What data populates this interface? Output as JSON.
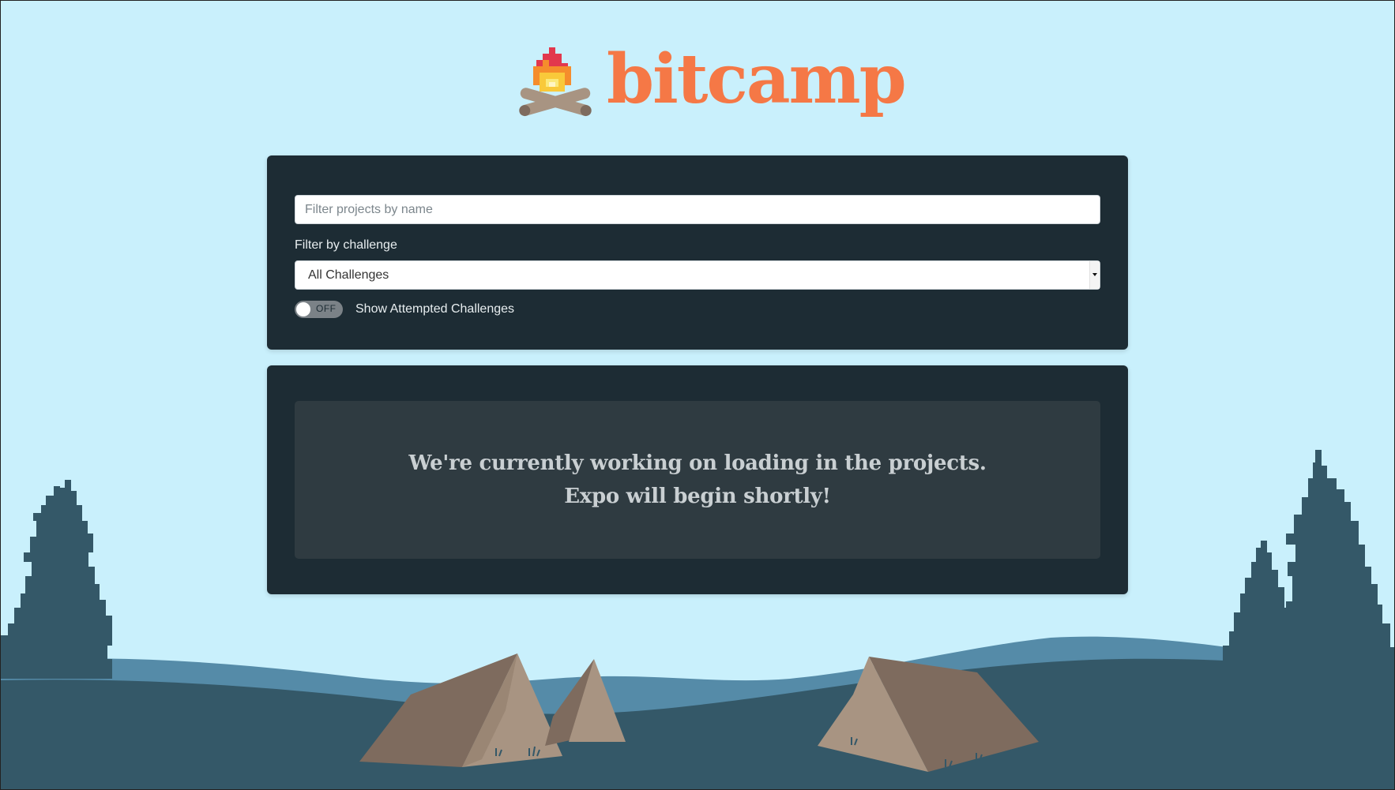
{
  "brand": {
    "name": "bitcamp",
    "accent_color": "#f57846",
    "icon": "campfire-icon"
  },
  "filters": {
    "search_placeholder": "Filter projects by name",
    "search_value": "",
    "challenge_label": "Filter by challenge",
    "challenge_selected": "All Challenges",
    "toggle_state": "OFF",
    "toggle_label": "Show Attempted Challenges"
  },
  "status": {
    "line1": "We're currently working on loading in the projects.",
    "line2": "Expo will begin shortly!"
  },
  "colors": {
    "sky": "#c9f0fc",
    "panel": "#1d2c34",
    "status_box": "#2f3b41",
    "hill_back": "#558ba8",
    "hill_front": "#345868",
    "tree": "#345868",
    "tent_light": "#a89482",
    "tent_dark": "#7e6b5e"
  }
}
